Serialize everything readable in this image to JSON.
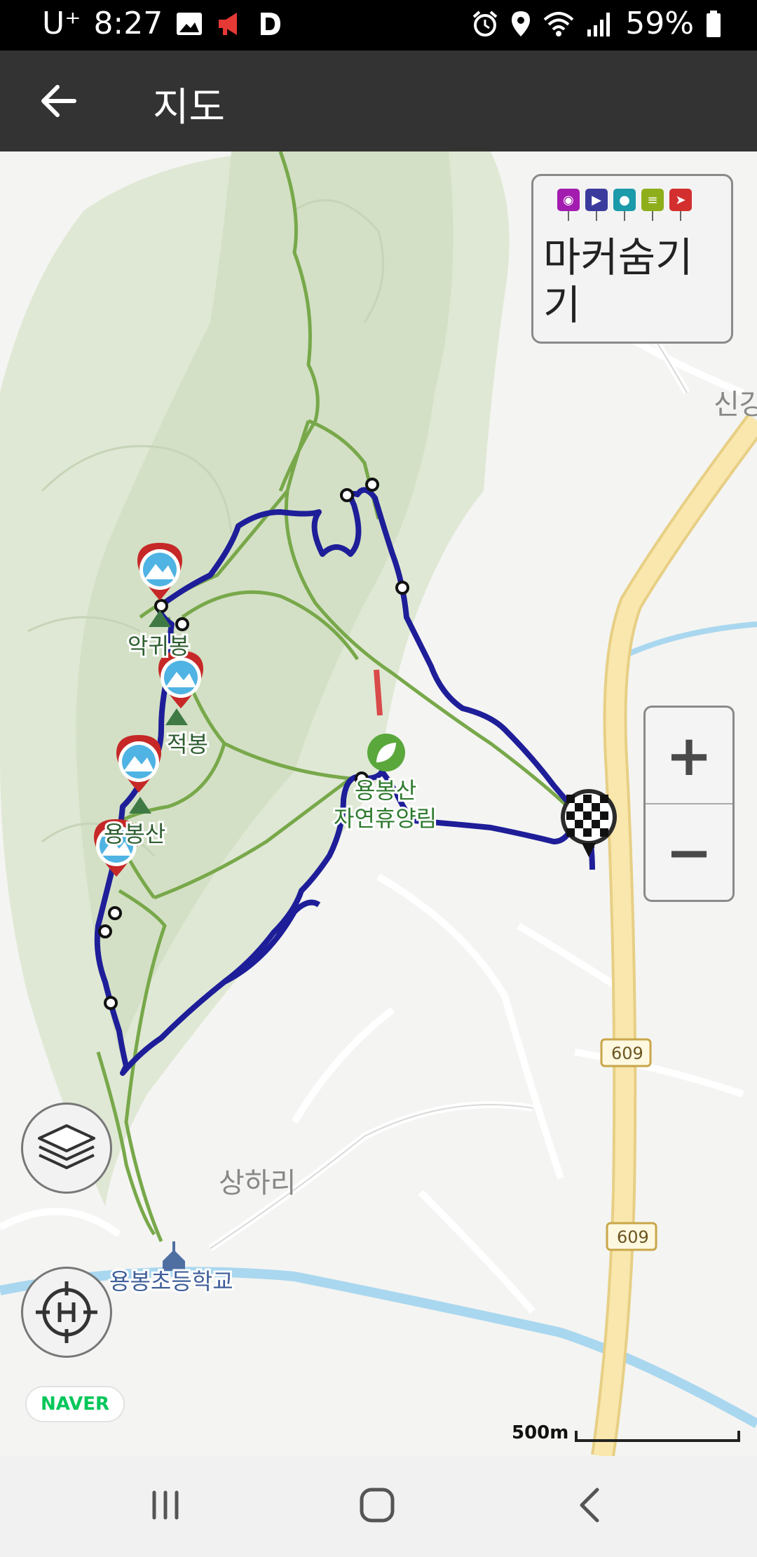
{
  "status_bar": {
    "carrier": "U⁺",
    "time": "8:27",
    "battery": "59%",
    "icons": [
      "image-icon",
      "megaphone-icon",
      "d-icon",
      "alarm-icon",
      "location-icon",
      "wifi-icon",
      "signal-icon",
      "battery-icon"
    ]
  },
  "app_bar": {
    "title": "지도",
    "back_icon": "arrow-left-icon"
  },
  "marker_panel": {
    "label": "마커숨기기",
    "icons": [
      "camera-icon",
      "video-icon",
      "microphone-icon",
      "note-icon",
      "flag-icon"
    ],
    "colors": [
      "#a21caf",
      "#3b3b9e",
      "#1b9aaa",
      "#8fae1b",
      "#d32f2f"
    ]
  },
  "map": {
    "labels": {
      "sin": "신강",
      "akgwibong": "악귀봉",
      "jeokbong": "적봉",
      "yongbongsan": "용봉산",
      "forest_line1": "용봉산",
      "forest_line2": "자연휴양림",
      "sanghari": "상하리",
      "school": "용봉초등학교",
      "route_top": "609",
      "route_bottom": "609"
    },
    "colors": {
      "track": "#1e1e99",
      "trail": "#7aaa4a",
      "highway": "#f7e4a6",
      "river": "#a9d7ef",
      "forest": "#dbe6cf"
    },
    "scale_label": "500m"
  },
  "zoom": {
    "plus": "+",
    "minus": "−"
  },
  "buttons": {
    "layers": "layers-icon",
    "locate": "locate-icon"
  },
  "attribution": "NAVER",
  "nav_bar": {
    "icons": [
      "recent-apps-icon",
      "home-icon",
      "back-icon"
    ]
  }
}
